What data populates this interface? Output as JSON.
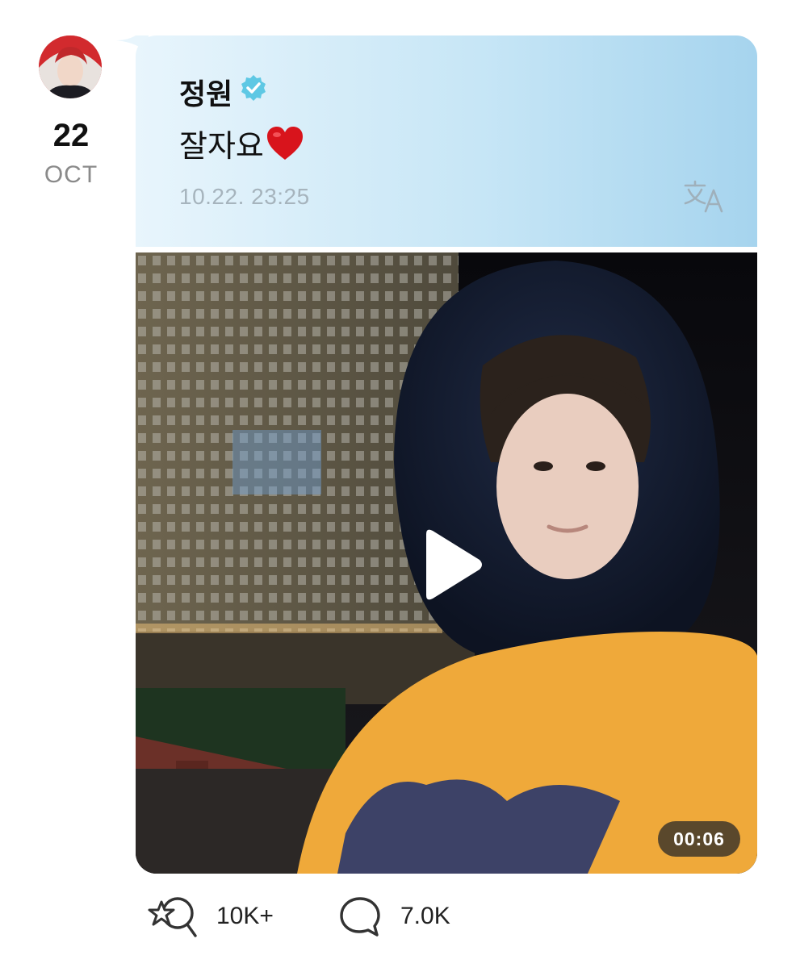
{
  "post": {
    "date_day": "22",
    "date_month": "OCT",
    "author": "정원",
    "message": "잘자요",
    "timestamp": "10.22. 23:25",
    "video_duration": "00:06"
  },
  "actions": {
    "likes_count": "10K+",
    "comments_count": "7.0K"
  },
  "colors": {
    "verified_badge": "#5ec8e4",
    "bubble_start": "#e8f5fc",
    "bubble_end": "#a6d4ee",
    "heart": "#d8141c"
  },
  "icons": [
    "avatar",
    "verified-icon",
    "heart-emoji",
    "translate-icon",
    "play-icon",
    "like-icon",
    "comment-icon"
  ]
}
